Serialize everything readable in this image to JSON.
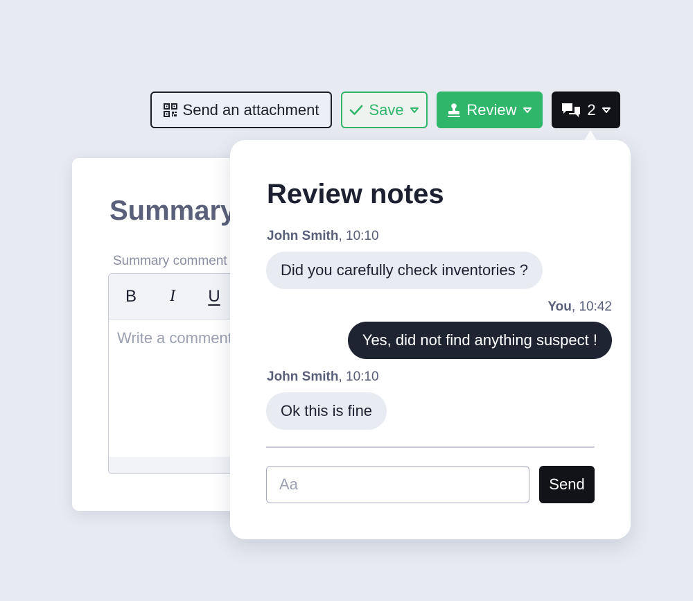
{
  "toolbar": {
    "attachment_label": "Send an attachment",
    "save_label": "Save",
    "review_label": "Review",
    "notes_count": "2"
  },
  "summary": {
    "title": "Summary",
    "comment_label": "Summary comment",
    "placeholder": "Write a comment",
    "format_buttons": {
      "bold": "B",
      "italic": "I",
      "underline": "U"
    }
  },
  "review_notes": {
    "title": "Review notes",
    "messages": [
      {
        "author": "John Smith",
        "time": ", 10:10",
        "text": "Did you carefully check inventories ?",
        "mine": false
      },
      {
        "author": "You",
        "time": ", 10:42",
        "text": "Yes, did not find anything suspect !",
        "mine": true
      },
      {
        "author": "John Smith",
        "time": ", 10:10",
        "text": "Ok this is fine",
        "mine": false
      }
    ],
    "input_placeholder": "Aa",
    "send_label": "Send"
  },
  "icons": {
    "attachment": "qr-code-icon",
    "save": "check-icon",
    "review": "stamp-icon",
    "notes": "chat-bubbles-icon",
    "dropdown": "caret-down-icon"
  },
  "colors": {
    "background": "#e7eaf1",
    "accent_green": "#2fb66b",
    "dark": "#111319",
    "bubble_out": "#1f2433",
    "bubble_in": "#e8ebf1"
  }
}
